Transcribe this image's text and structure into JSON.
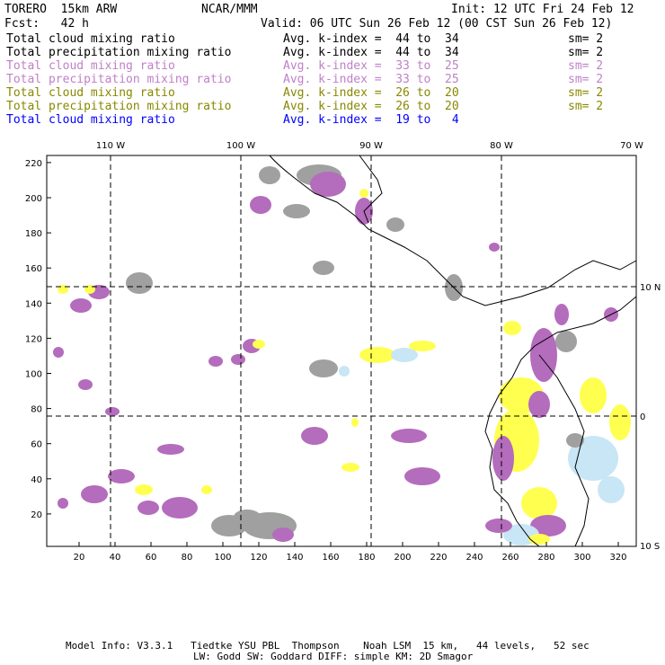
{
  "header": {
    "model": "TORERO  15km ARW",
    "org": "NCAR/MMM",
    "init": "Init: 12 UTC Fri 24 Feb 12",
    "fcst": "Fcst:   42 h",
    "valid": "Valid: 06 UTC Sun 26 Feb 12 (00 CST Sun 26 Feb 12)"
  },
  "legend": [
    {
      "field": "Total cloud mixing ratio",
      "range": "Avg. k-index =  44 to  34",
      "sm": "sm= 2",
      "color": "#000000"
    },
    {
      "field": "Total precipitation mixing ratio",
      "range": "Avg. k-index =  44 to  34",
      "sm": "sm= 2",
      "color": "#000000"
    },
    {
      "field": "Total cloud mixing ratio",
      "range": "Avg. k-index =  33 to  25",
      "sm": "sm= 2",
      "color": "#c080c8"
    },
    {
      "field": "Total precipitation mixing ratio",
      "range": "Avg. k-index =  33 to  25",
      "sm": "sm= 2",
      "color": "#c080c8"
    },
    {
      "field": "Total cloud mixing ratio",
      "range": "Avg. k-index =  26 to  20",
      "sm": "sm= 2",
      "color": "#888800"
    },
    {
      "field": "Total precipitation mixing ratio",
      "range": "Avg. k-index =  26 to  20",
      "sm": "sm= 2",
      "color": "#888800"
    },
    {
      "field": "Total cloud mixing ratio",
      "range": "Avg. k-index =  19 to   4",
      "sm": "",
      "color": "#0000ff"
    }
  ],
  "map": {
    "lon_labels": [
      "110 W",
      "100 W",
      "90 W",
      "80 W",
      "70 W"
    ],
    "lat_labels": [
      "10 N",
      "0",
      "10 S"
    ],
    "x_ticks": [
      "20",
      "40",
      "60",
      "80",
      "100",
      "120",
      "140",
      "160",
      "180",
      "200",
      "220",
      "240",
      "260",
      "280",
      "300",
      "320"
    ],
    "y_ticks": [
      "20",
      "40",
      "60",
      "80",
      "100",
      "120",
      "140",
      "160",
      "180",
      "200",
      "220"
    ],
    "colors": {
      "gray": "#a0a0a0",
      "purple": "#b46cbc",
      "yellow": "#ffff50",
      "lightblue": "#c8e6f5"
    }
  },
  "footer": {
    "line1": "Model Info: V3.3.1   Tiedtke YSU PBL  Thompson    Noah LSM  15 km,   44 levels,   52 sec",
    "line2": "LW: Godd SW: Goddard DIFF: simple KM: 2D Smagor"
  }
}
